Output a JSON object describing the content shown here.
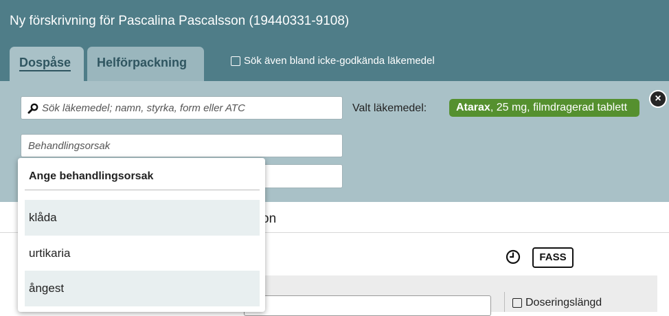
{
  "window": {
    "title": "Ny förskrivning för Pascalina Pascalsson (19440331-9108)"
  },
  "tabs": [
    {
      "label": "Dospåse",
      "active": true
    },
    {
      "label": "Helförpackning",
      "active": false
    }
  ],
  "include_unapproved": {
    "label": "Sök även bland icke-godkända läkemedel",
    "checked": false
  },
  "search": {
    "placeholder": "Sök läkemedel; namn, styrka, form eller ATC"
  },
  "selected_drug": {
    "label": "Valt läkemedel:",
    "name": "Atarax",
    "details": ", 25 mg, filmdragerad tablett",
    "color": "#55902f"
  },
  "treatment_reason": {
    "placeholder": "Behandlingsorsak"
  },
  "dropdown": {
    "header": "Ange behandlingsorsak",
    "items": [
      "klåda",
      "urtikaria",
      "ångest"
    ]
  },
  "section": {
    "partial_heading": "on"
  },
  "tools": {
    "fass_label": "FASS"
  },
  "dosing": {
    "length_label": "Doseringslängd",
    "checked": false
  },
  "colors": {
    "header_bg": "#4f7d88",
    "panel_bg": "#a9c1c7",
    "accent_green": "#55902f"
  }
}
